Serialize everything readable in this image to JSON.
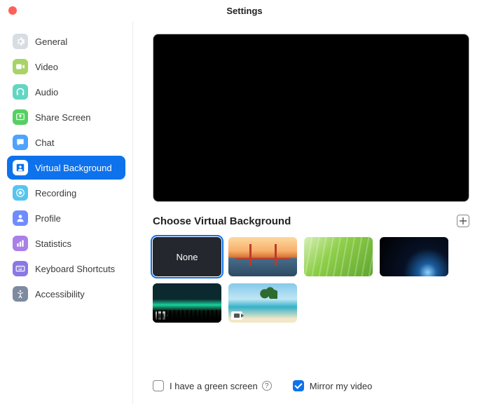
{
  "window": {
    "title": "Settings"
  },
  "sidebar": {
    "items": [
      {
        "label": "General",
        "icon": "gear-icon",
        "color": "#d8dde2",
        "active": false
      },
      {
        "label": "Video",
        "icon": "video-icon",
        "color": "#a8d366",
        "active": false
      },
      {
        "label": "Audio",
        "icon": "headphones-icon",
        "color": "#63d6c2",
        "active": false
      },
      {
        "label": "Share Screen",
        "icon": "share-icon",
        "color": "#55d063",
        "active": false
      },
      {
        "label": "Chat",
        "icon": "chat-icon",
        "color": "#4da3ff",
        "active": false
      },
      {
        "label": "Virtual Background",
        "icon": "portrait-icon",
        "color": "#ffffff",
        "active": true
      },
      {
        "label": "Recording",
        "icon": "record-icon",
        "color": "#57c4ef",
        "active": false
      },
      {
        "label": "Profile",
        "icon": "profile-icon",
        "color": "#6f8cff",
        "active": false
      },
      {
        "label": "Statistics",
        "icon": "stats-icon",
        "color": "#a97fe8",
        "active": false
      },
      {
        "label": "Keyboard Shortcuts",
        "icon": "keyboard-icon",
        "color": "#8a78e5",
        "active": false
      },
      {
        "label": "Accessibility",
        "icon": "accessibility-icon",
        "color": "#7d8aa0",
        "active": false
      }
    ]
  },
  "main": {
    "section_title": "Choose Virtual Background",
    "backgrounds": [
      {
        "label": "None",
        "type": "none",
        "selected": true,
        "is_video": false
      },
      {
        "label": "",
        "type": "bridge",
        "selected": false,
        "is_video": false
      },
      {
        "label": "",
        "type": "grass",
        "selected": false,
        "is_video": false
      },
      {
        "label": "",
        "type": "space",
        "selected": false,
        "is_video": false
      },
      {
        "label": "",
        "type": "aurora",
        "selected": false,
        "is_video": true
      },
      {
        "label": "",
        "type": "beach",
        "selected": false,
        "is_video": true
      }
    ],
    "green_screen": {
      "label": "I have a green screen",
      "checked": false
    },
    "mirror": {
      "label": "Mirror my video",
      "checked": true
    }
  }
}
